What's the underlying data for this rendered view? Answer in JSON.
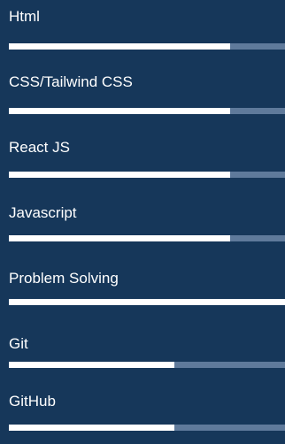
{
  "skills": [
    {
      "label": "Html",
      "level_percent": 80
    },
    {
      "label": "CSS/Tailwind CSS",
      "level_percent": 80
    },
    {
      "label": "React JS",
      "level_percent": 80
    },
    {
      "label": "Javascript",
      "level_percent": 80
    },
    {
      "label": "Problem Solving",
      "level_percent": 100
    },
    {
      "label": "Git",
      "level_percent": 60
    },
    {
      "label": "GitHub",
      "level_percent": 60
    }
  ],
  "colors": {
    "background": "#16375a",
    "bar_track": "#5f7a9b",
    "bar_fill": "#ffffff",
    "text": "#ffffff"
  }
}
